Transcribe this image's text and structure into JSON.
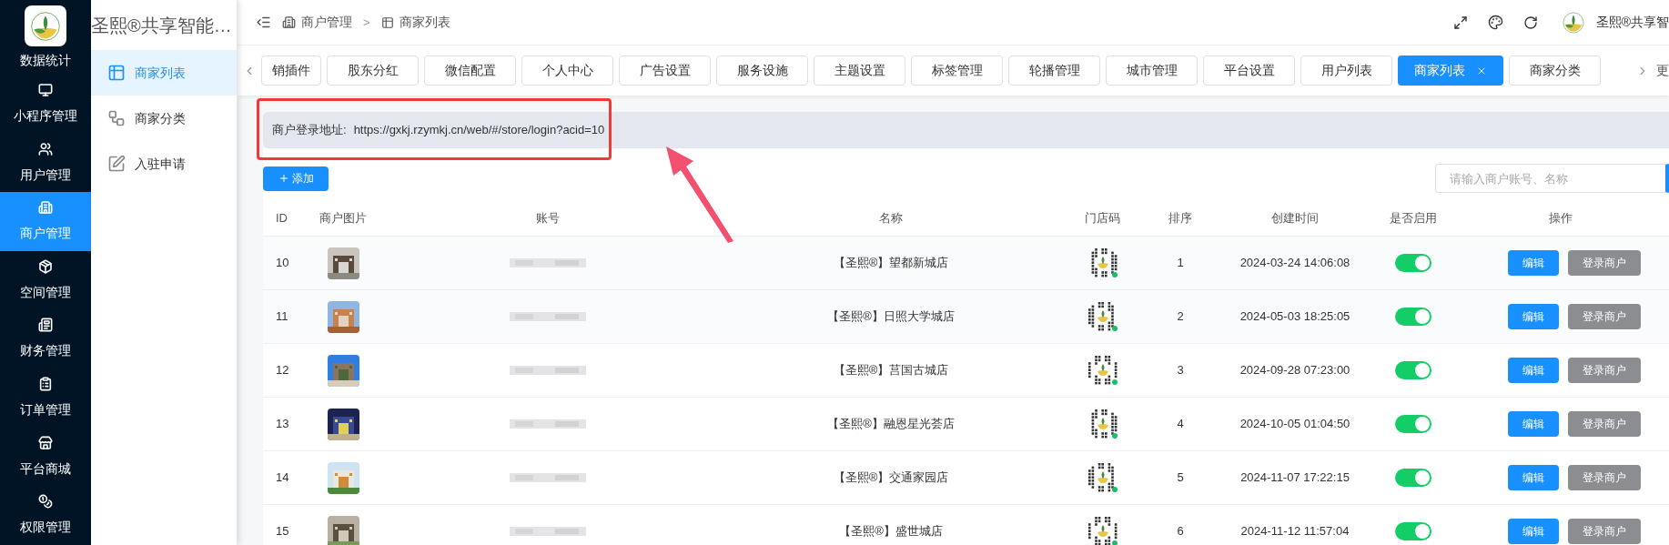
{
  "nav": {
    "items": [
      {
        "label": "数据统计",
        "selected": false
      },
      {
        "label": "小程序管理",
        "selected": false
      },
      {
        "label": "用户管理",
        "selected": false
      },
      {
        "label": "商户管理",
        "selected": true
      },
      {
        "label": "空间管理",
        "selected": false
      },
      {
        "label": "财务管理",
        "selected": false
      },
      {
        "label": "订单管理",
        "selected": false
      },
      {
        "label": "平台商城",
        "selected": false
      },
      {
        "label": "权限管理",
        "selected": false
      }
    ]
  },
  "submenu": {
    "title": "圣熙®共享智能…",
    "items": [
      {
        "label": "商家列表",
        "selected": true
      },
      {
        "label": "商家分类",
        "selected": false
      },
      {
        "label": "入驻申请",
        "selected": false
      }
    ]
  },
  "breadcrumb": [
    "商户管理",
    "商家列表"
  ],
  "breadcrumb_separator": ">",
  "user_name": "圣熙®共享智",
  "tabs": [
    {
      "label": "销插件",
      "selected": false
    },
    {
      "label": "股东分红",
      "selected": false
    },
    {
      "label": "微信配置",
      "selected": false
    },
    {
      "label": "个人中心",
      "selected": false
    },
    {
      "label": "广告设置",
      "selected": false
    },
    {
      "label": "服务设施",
      "selected": false
    },
    {
      "label": "主题设置",
      "selected": false
    },
    {
      "label": "标签管理",
      "selected": false
    },
    {
      "label": "轮播管理",
      "selected": false
    },
    {
      "label": "城市管理",
      "selected": false
    },
    {
      "label": "平台设置",
      "selected": false
    },
    {
      "label": "用户列表",
      "selected": false
    },
    {
      "label": "商家列表",
      "selected": true
    },
    {
      "label": "商家分类",
      "selected": false
    }
  ],
  "tabs_more": "更",
  "login_url": {
    "label": "商户登录地址:",
    "value": "https://gxkj.rzymkj.cn/web/#/store/login?acid=10"
  },
  "add_button": "添加",
  "search": {
    "placeholder": "请输入商户账号、名称"
  },
  "table": {
    "columns": [
      "ID",
      "商户图片",
      "账号",
      "名称",
      "门店码",
      "排序",
      "创建时间",
      "是否启用",
      "操作"
    ],
    "rows": [
      {
        "id": "10",
        "name": "【圣熙®】望都新城店",
        "sort": "1",
        "created": "2024-03-24 14:06:08",
        "enabled": true,
        "actions": [
          "编辑",
          "登录商户"
        ]
      },
      {
        "id": "11",
        "name": "【圣熙®】日照大学城店",
        "sort": "2",
        "created": "2024-05-03 18:25:05",
        "enabled": true,
        "actions": [
          "编辑",
          "登录商户"
        ]
      },
      {
        "id": "12",
        "name": "【圣熙®】莒国古城店",
        "sort": "3",
        "created": "2024-09-28 07:23:00",
        "enabled": true,
        "actions": [
          "编辑",
          "登录商户"
        ]
      },
      {
        "id": "13",
        "name": "【圣熙®】融恩星光荟店",
        "sort": "4",
        "created": "2024-10-05 01:04:50",
        "enabled": true,
        "actions": [
          "编辑",
          "登录商户"
        ]
      },
      {
        "id": "14",
        "name": "【圣熙®】交通家园店",
        "sort": "5",
        "created": "2024-11-07 17:22:15",
        "enabled": true,
        "actions": [
          "编辑",
          "登录商户"
        ]
      },
      {
        "id": "15",
        "name": "【圣熙®】盛世城店",
        "sort": "6",
        "created": "2024-11-12 11:57:04",
        "enabled": true,
        "actions": [
          "编辑",
          "登录商户"
        ]
      }
    ]
  }
}
